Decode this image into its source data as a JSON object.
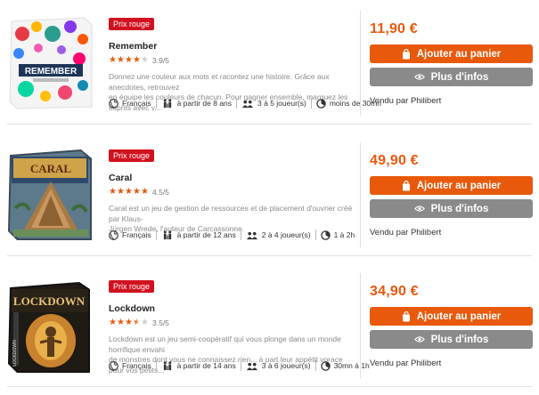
{
  "products": [
    {
      "badge": "Prix rouge",
      "title": "Remember",
      "rating": 3.9,
      "rating_text": "3.9/5",
      "stars": [
        1,
        1,
        1,
        1,
        0
      ],
      "description_line1": "Donnez une couleur aux mots et racontez une histoire. Grâce aux anecdotes, retrouvez",
      "description_line2": "en équipe les couleurs de chacun. Pour gagner ensemble, marquez les esprits avec v...",
      "language": "Français",
      "age": "à partir de 8 ans",
      "players": "3 à 5 joueur(s)",
      "duration": "moins de 30mn",
      "price": "11,90 €",
      "cart_label": "Ajouter au panier",
      "info_label": "Plus d'infos",
      "seller": "Vendu par Philibert",
      "box_text": "REMEMBER"
    },
    {
      "badge": "Prix rouge",
      "title": "Caral",
      "rating": 4.5,
      "rating_text": "4.5/5",
      "stars": [
        1,
        1,
        1,
        1,
        1
      ],
      "description_line1": "Caral est un jeu de gestion de ressources et de placement d'ouvrier créé par Klaus-",
      "description_line2": "Jürgen Wrede, l'auteur de Carcassonne.",
      "language": "Français",
      "age": "à partir de 12 ans",
      "players": "2 à 4 joueur(s)",
      "duration": "1 à 2h",
      "price": "49,90 €",
      "cart_label": "Ajouter au panier",
      "info_label": "Plus d'infos",
      "seller": "Vendu par Philibert",
      "box_text": "CARAL"
    },
    {
      "badge": "Prix rouge",
      "title": "Lockdown",
      "rating": 3.5,
      "rating_text": "3.5/5",
      "stars": [
        1,
        1,
        1,
        0.5,
        0
      ],
      "description_line1": "Lockdown est un jeu semi-coopératif qui vous plonge dans un monde horrifique envahi",
      "description_line2": "de monstres dont vous ne connaissez rien... à part leur appétit vorace pour vos petits...",
      "language": "Français",
      "age": "à partir de 14 ans",
      "players": "3 à 6 joueur(s)",
      "duration": "30mn à 1h",
      "price": "34,90 €",
      "cart_label": "Ajouter au panier",
      "info_label": "Plus d'infos",
      "seller": "Vendu par Philibert",
      "box_text": "LOCKDOWN"
    }
  ],
  "colors": {
    "accent": "#e8590c",
    "badge": "#d0121f",
    "info_button": "#8a8a8a"
  }
}
